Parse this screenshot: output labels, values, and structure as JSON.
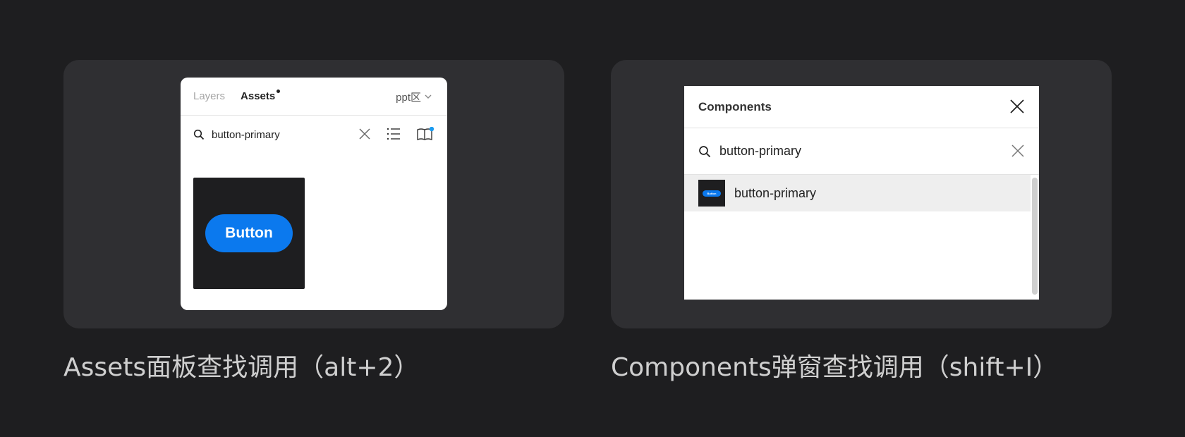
{
  "left_example": {
    "caption": "Assets面板查找调用（alt+2）",
    "assets_panel": {
      "tabs": [
        {
          "label": "Layers",
          "active": false
        },
        {
          "label": "Assets",
          "active": true
        }
      ],
      "page_selector": "ppt区",
      "search": {
        "value": "button-primary"
      },
      "thumbnail": {
        "button_label": "Button",
        "button_color": "#0b79ee"
      }
    }
  },
  "right_example": {
    "caption": "Components弹窗查找调用（shift+I）",
    "components_dialog": {
      "title": "Components",
      "search": {
        "value": "button-primary"
      },
      "results": [
        {
          "label": "button-primary",
          "thumb_label": "Button"
        }
      ]
    }
  },
  "colors": {
    "background": "#1e1e20",
    "card": "#2f2f32",
    "accent": "#0b79ee",
    "notification_dot": "#1a9bf0"
  }
}
